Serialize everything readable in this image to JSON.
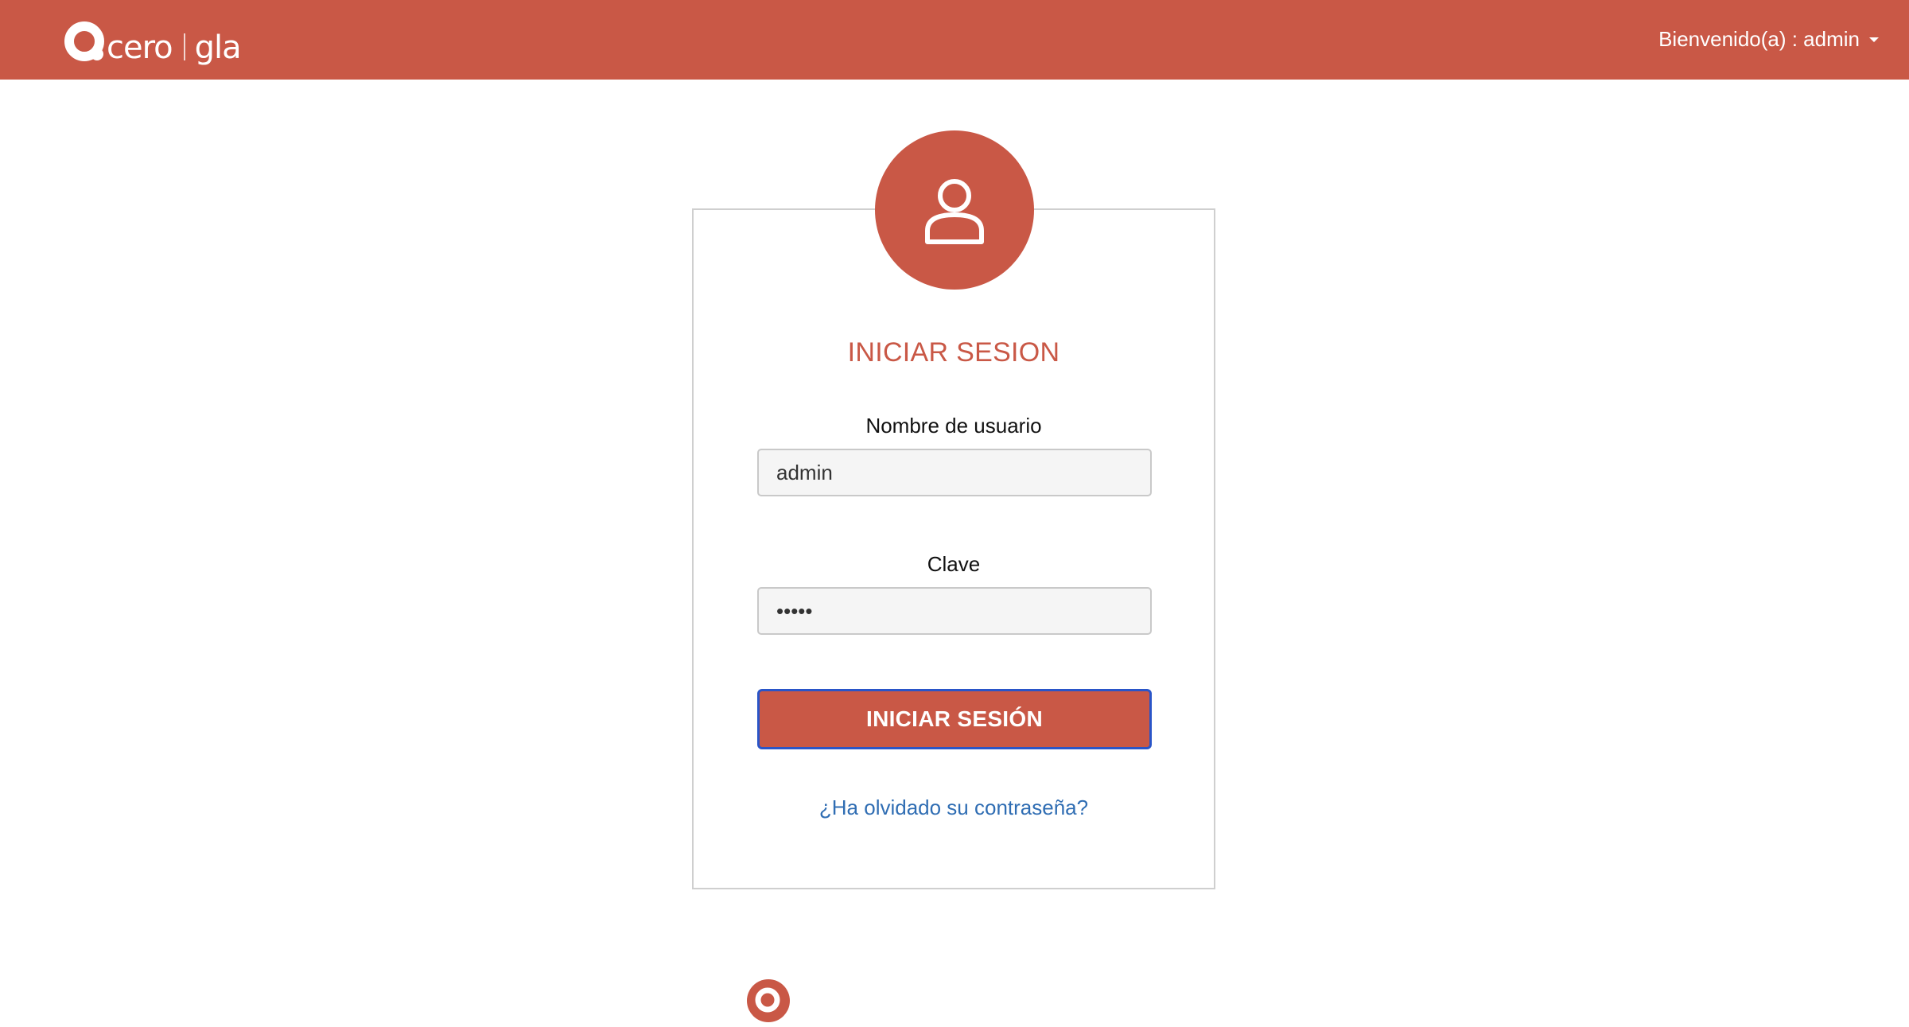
{
  "header": {
    "brand_left": "cero",
    "brand_right": "gla",
    "user_menu_label": "Bienvenido(a) : admin",
    "background_color": "#c95846"
  },
  "login": {
    "title": "INICIAR SESION",
    "username_label": "Nombre de usuario",
    "username_value": "admin",
    "password_label": "Clave",
    "password_value": "admin",
    "submit_label": "INICIAR SESIÓN",
    "forgot_link": "¿Ha olvidado su contraseña?",
    "accent_color": "#c95846",
    "link_color": "#2f6db3"
  },
  "icons": {
    "avatar": "user-icon",
    "caret": "chevron-down-icon",
    "brand": "logo-mark"
  }
}
